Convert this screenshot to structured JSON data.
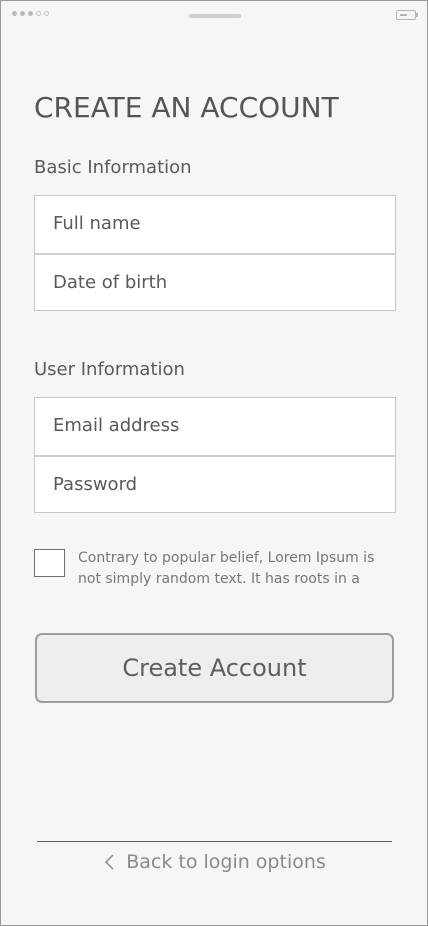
{
  "status_bar": {
    "dots": [
      "filled",
      "filled",
      "filled",
      "hollow",
      "hollow"
    ],
    "battery": "battery-icon"
  },
  "page": {
    "title": "CREATE AN ACCOUNT"
  },
  "basic_info": {
    "label": "Basic Information",
    "fields": [
      {
        "placeholder": "Full name"
      },
      {
        "placeholder": "Date of birth"
      }
    ]
  },
  "user_info": {
    "label": "User Information",
    "fields": [
      {
        "placeholder": "Email address"
      },
      {
        "placeholder": "Password"
      }
    ]
  },
  "terms": {
    "checked": false,
    "text": "Contrary to popular belief, Lorem Ipsum is not simply random text. It has roots in a"
  },
  "actions": {
    "create_label": "Create Account"
  },
  "footer": {
    "back_label": "Back to login options",
    "back_icon": "chevron-left-icon"
  },
  "colors": {
    "background": "#f6f6f6",
    "text": "#555555",
    "border": "#c9c9c9",
    "button_bg": "#eeeeee"
  }
}
